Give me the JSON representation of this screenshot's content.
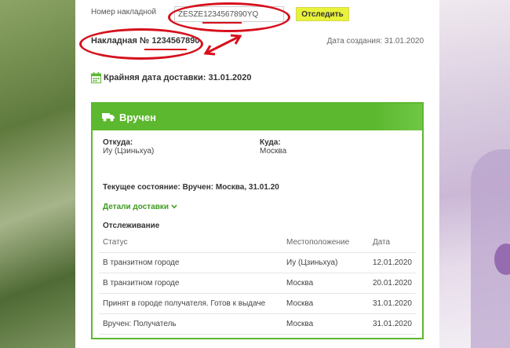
{
  "form": {
    "label": "Номер накладной",
    "input_value": "ZESZE1234567890YQ",
    "button": "Отследить"
  },
  "waybill": {
    "label": "Накладная №",
    "number": "1234567890",
    "created": "Дата создания: 31.01.2020"
  },
  "deadline": "Крайняя дата доставки: 31.01.2020",
  "status_card": {
    "title": "Вручен",
    "from_label": "Откуда:",
    "from_value": "Иу (Цзиньхуа)",
    "to_label": "Куда:",
    "to_value": "Москва",
    "current_state": "Текущее состояние: Вручен: Москва, 31.01.20",
    "details_link": "Детали доставки",
    "tracking_title": "Отслеживание",
    "headers": [
      "Статус",
      "Местоположение",
      "Дата"
    ],
    "rows": [
      [
        "В транзитном городе",
        "Иу (Цзиньхуа)",
        "12.01.2020"
      ],
      [
        "В транзитном городе",
        "Москва",
        "20.01.2020"
      ],
      [
        "Принят в городе получателя. Готов к выдаче",
        "Москва",
        "31.01.2020"
      ],
      [
        "Вручен: Получатель",
        "Москва",
        "31.01.2020"
      ]
    ]
  },
  "colors": {
    "accent": "#5cb82e",
    "button": "#e9f23a",
    "annotation": "#d6101c"
  },
  "icons": [
    "calendar-icon",
    "truck-icon",
    "chevron-down-icon"
  ]
}
